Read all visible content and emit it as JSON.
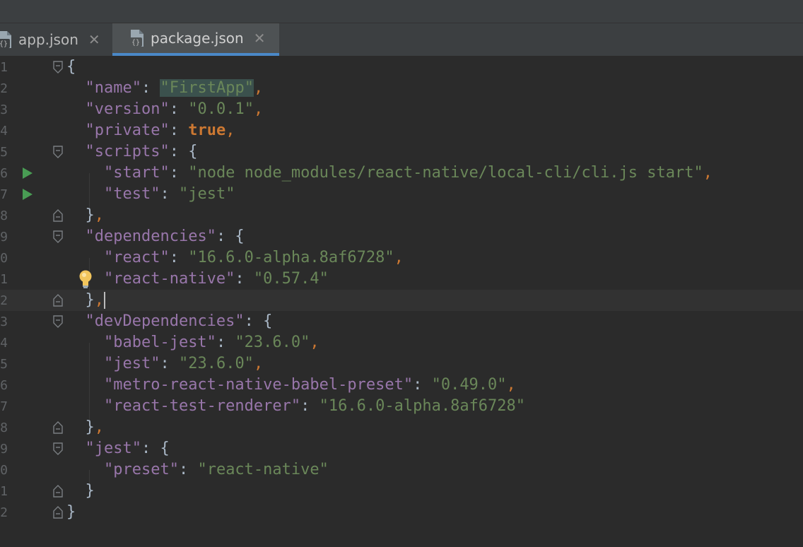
{
  "tabs": [
    {
      "label": "app.json",
      "active": false
    },
    {
      "label": "package.json",
      "active": true
    }
  ],
  "editor": {
    "line_numbers": [
      "1",
      "2",
      "3",
      "4",
      "5",
      "6",
      "7",
      "8",
      "9",
      "0",
      "1",
      "2",
      "3",
      "4",
      "5",
      "6",
      "7",
      "8",
      "9",
      "0",
      "1",
      "2"
    ],
    "current_line_index": 11
  },
  "code": {
    "l1_open": "{",
    "name_key": "\"name\"",
    "name_val": "\"FirstApp\"",
    "version_key": "\"version\"",
    "version_val": "\"0.0.1\"",
    "private_key": "\"private\"",
    "private_val": "true",
    "scripts_key": "\"scripts\"",
    "start_key": "\"start\"",
    "start_val": "\"node node_modules/react-native/local-cli/cli.js start\"",
    "test_key": "\"test\"",
    "test_val": "\"jest\"",
    "dependencies_key": "\"dependencies\"",
    "react_key": "\"react\"",
    "react_val": "\"16.6.0-alpha.8af6728\"",
    "react_native_key": "\"react-native\"",
    "react_native_val": "\"0.57.4\"",
    "devdeps_key": "\"devDependencies\"",
    "babel_jest_key": "\"babel-jest\"",
    "babel_jest_val": "\"23.6.0\"",
    "jest_dep_key": "\"jest\"",
    "jest_dep_val": "\"23.6.0\"",
    "metro_key": "\"metro-react-native-babel-preset\"",
    "metro_val": "\"0.49.0\"",
    "rtr_key": "\"react-test-renderer\"",
    "rtr_val": "\"16.6.0-alpha.8af6728\"",
    "jest_key": "\"jest\"",
    "preset_key": "\"preset\"",
    "preset_val": "\"react-native\""
  },
  "colors": {
    "background": "#2b2b2b",
    "key": "#9876aa",
    "string": "#6a8759",
    "keyword": "#cc7832",
    "run_icon": "#499c54",
    "tab_underline": "#4a88c7"
  },
  "icons": [
    "json-file-icon",
    "close-icon",
    "run-icon",
    "fold-icon",
    "intention-bulb-icon"
  ]
}
